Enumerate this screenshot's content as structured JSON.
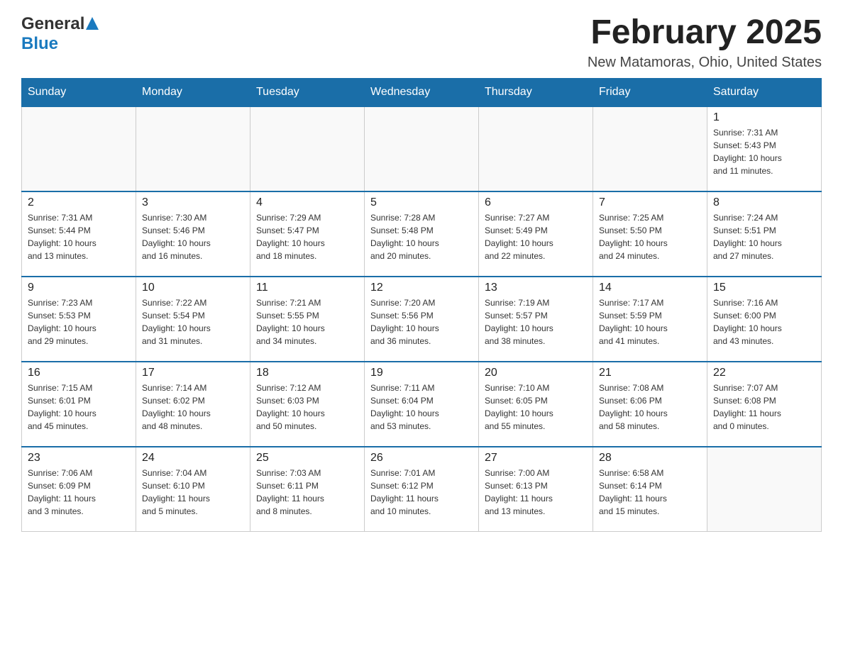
{
  "header": {
    "logo_general": "General",
    "logo_blue": "Blue",
    "title": "February 2025",
    "subtitle": "New Matamoras, Ohio, United States"
  },
  "weekdays": [
    "Sunday",
    "Monday",
    "Tuesday",
    "Wednesday",
    "Thursday",
    "Friday",
    "Saturday"
  ],
  "weeks": [
    [
      {
        "day": "",
        "info": ""
      },
      {
        "day": "",
        "info": ""
      },
      {
        "day": "",
        "info": ""
      },
      {
        "day": "",
        "info": ""
      },
      {
        "day": "",
        "info": ""
      },
      {
        "day": "",
        "info": ""
      },
      {
        "day": "1",
        "info": "Sunrise: 7:31 AM\nSunset: 5:43 PM\nDaylight: 10 hours\nand 11 minutes."
      }
    ],
    [
      {
        "day": "2",
        "info": "Sunrise: 7:31 AM\nSunset: 5:44 PM\nDaylight: 10 hours\nand 13 minutes."
      },
      {
        "day": "3",
        "info": "Sunrise: 7:30 AM\nSunset: 5:46 PM\nDaylight: 10 hours\nand 16 minutes."
      },
      {
        "day": "4",
        "info": "Sunrise: 7:29 AM\nSunset: 5:47 PM\nDaylight: 10 hours\nand 18 minutes."
      },
      {
        "day": "5",
        "info": "Sunrise: 7:28 AM\nSunset: 5:48 PM\nDaylight: 10 hours\nand 20 minutes."
      },
      {
        "day": "6",
        "info": "Sunrise: 7:27 AM\nSunset: 5:49 PM\nDaylight: 10 hours\nand 22 minutes."
      },
      {
        "day": "7",
        "info": "Sunrise: 7:25 AM\nSunset: 5:50 PM\nDaylight: 10 hours\nand 24 minutes."
      },
      {
        "day": "8",
        "info": "Sunrise: 7:24 AM\nSunset: 5:51 PM\nDaylight: 10 hours\nand 27 minutes."
      }
    ],
    [
      {
        "day": "9",
        "info": "Sunrise: 7:23 AM\nSunset: 5:53 PM\nDaylight: 10 hours\nand 29 minutes."
      },
      {
        "day": "10",
        "info": "Sunrise: 7:22 AM\nSunset: 5:54 PM\nDaylight: 10 hours\nand 31 minutes."
      },
      {
        "day": "11",
        "info": "Sunrise: 7:21 AM\nSunset: 5:55 PM\nDaylight: 10 hours\nand 34 minutes."
      },
      {
        "day": "12",
        "info": "Sunrise: 7:20 AM\nSunset: 5:56 PM\nDaylight: 10 hours\nand 36 minutes."
      },
      {
        "day": "13",
        "info": "Sunrise: 7:19 AM\nSunset: 5:57 PM\nDaylight: 10 hours\nand 38 minutes."
      },
      {
        "day": "14",
        "info": "Sunrise: 7:17 AM\nSunset: 5:59 PM\nDaylight: 10 hours\nand 41 minutes."
      },
      {
        "day": "15",
        "info": "Sunrise: 7:16 AM\nSunset: 6:00 PM\nDaylight: 10 hours\nand 43 minutes."
      }
    ],
    [
      {
        "day": "16",
        "info": "Sunrise: 7:15 AM\nSunset: 6:01 PM\nDaylight: 10 hours\nand 45 minutes."
      },
      {
        "day": "17",
        "info": "Sunrise: 7:14 AM\nSunset: 6:02 PM\nDaylight: 10 hours\nand 48 minutes."
      },
      {
        "day": "18",
        "info": "Sunrise: 7:12 AM\nSunset: 6:03 PM\nDaylight: 10 hours\nand 50 minutes."
      },
      {
        "day": "19",
        "info": "Sunrise: 7:11 AM\nSunset: 6:04 PM\nDaylight: 10 hours\nand 53 minutes."
      },
      {
        "day": "20",
        "info": "Sunrise: 7:10 AM\nSunset: 6:05 PM\nDaylight: 10 hours\nand 55 minutes."
      },
      {
        "day": "21",
        "info": "Sunrise: 7:08 AM\nSunset: 6:06 PM\nDaylight: 10 hours\nand 58 minutes."
      },
      {
        "day": "22",
        "info": "Sunrise: 7:07 AM\nSunset: 6:08 PM\nDaylight: 11 hours\nand 0 minutes."
      }
    ],
    [
      {
        "day": "23",
        "info": "Sunrise: 7:06 AM\nSunset: 6:09 PM\nDaylight: 11 hours\nand 3 minutes."
      },
      {
        "day": "24",
        "info": "Sunrise: 7:04 AM\nSunset: 6:10 PM\nDaylight: 11 hours\nand 5 minutes."
      },
      {
        "day": "25",
        "info": "Sunrise: 7:03 AM\nSunset: 6:11 PM\nDaylight: 11 hours\nand 8 minutes."
      },
      {
        "day": "26",
        "info": "Sunrise: 7:01 AM\nSunset: 6:12 PM\nDaylight: 11 hours\nand 10 minutes."
      },
      {
        "day": "27",
        "info": "Sunrise: 7:00 AM\nSunset: 6:13 PM\nDaylight: 11 hours\nand 13 minutes."
      },
      {
        "day": "28",
        "info": "Sunrise: 6:58 AM\nSunset: 6:14 PM\nDaylight: 11 hours\nand 15 minutes."
      },
      {
        "day": "",
        "info": ""
      }
    ]
  ]
}
